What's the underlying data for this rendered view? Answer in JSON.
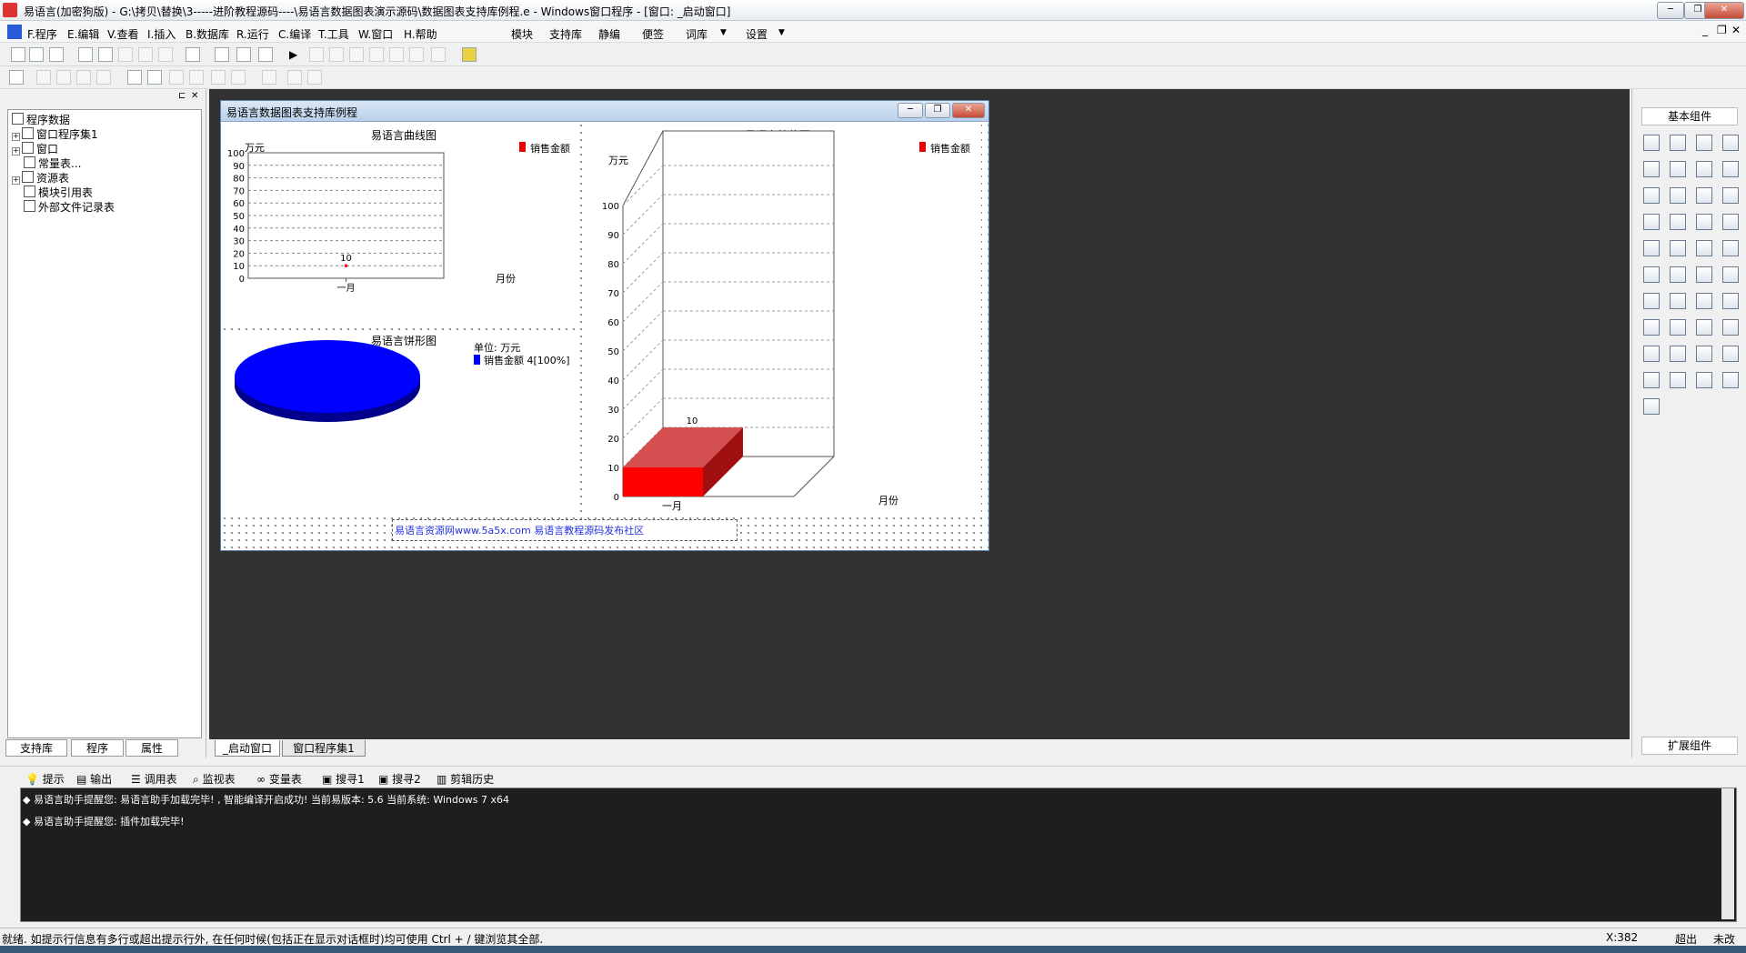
{
  "window": {
    "title": "易语言(加密狗版) - G:\\拷贝\\替换\\3-----进阶教程源码----\\易语言数据图表演示源码\\数据图表支持库例程.e - Windows窗口程序 - [窗口: _启动窗口]"
  },
  "menubar": {
    "items": [
      "F.程序",
      "E.编辑",
      "V.查看",
      "I.插入",
      "B.数据库",
      "R.运行",
      "C.编译",
      "T.工具",
      "W.窗口",
      "H.帮助"
    ],
    "right_items": [
      "模块",
      "支持库",
      "静编",
      "便签",
      "词库",
      "设置"
    ]
  },
  "leftpanel": {
    "tree": {
      "root": "程序数据",
      "children": [
        "窗口程序集1",
        "窗口",
        "常量表...",
        "资源表",
        "模块引用表",
        "外部文件记录表"
      ]
    },
    "tabs": [
      "支持库",
      "程序",
      "属性"
    ]
  },
  "editor_tabs": [
    "_启动窗口",
    "窗口程序集1"
  ],
  "form": {
    "title": "易语言数据图表支持库例程",
    "line_chart": {
      "title": "易语言曲线图",
      "legend": "销售金额",
      "ylabel": "万元",
      "xlabel": "月份"
    },
    "bar_chart": {
      "title": "易语言柱状图",
      "legend": "销售金额",
      "ylabel": "万元",
      "xlabel": "月份"
    },
    "pie_chart": {
      "title": "易语言饼形图",
      "unit": "单位: 万元",
      "legend": "销售金额 4[100%]"
    },
    "label_text": "易语言资源网www.5a5x.com 易语言教程源码发布社区"
  },
  "chart_data": [
    {
      "type": "line",
      "title": "易语言曲线图",
      "categories": [
        "一月"
      ],
      "series": [
        {
          "name": "销售金额",
          "values": [
            10
          ]
        }
      ],
      "ylabel": "万元",
      "xlabel": "月份",
      "ylim": [
        0,
        100
      ],
      "yticks": [
        0,
        10,
        20,
        30,
        40,
        50,
        60,
        70,
        80,
        90,
        100
      ],
      "color": "#ff0000"
    },
    {
      "type": "bar",
      "title": "易语言柱状图",
      "categories": [
        "一月"
      ],
      "series": [
        {
          "name": "销售金额",
          "values": [
            10
          ]
        }
      ],
      "ylabel": "万元",
      "xlabel": "月份",
      "ylim": [
        0,
        100
      ],
      "yticks": [
        0,
        10,
        20,
        30,
        40,
        50,
        60,
        70,
        80,
        90,
        100
      ],
      "color": "#ff0000"
    },
    {
      "type": "pie",
      "title": "易语言饼形图",
      "slices": [
        {
          "label": "销售金额",
          "value": 4,
          "percent": "100%"
        }
      ],
      "color": "#0000ff"
    }
  ],
  "toolbox": {
    "title": "基本组件",
    "footer": "扩展组件"
  },
  "output_tabs": [
    "提示",
    "输出",
    "调用表",
    "监视表",
    "变量表",
    "搜寻1",
    "搜寻2",
    "剪辑历史"
  ],
  "output_lines": [
    "◆ 易语言助手提醒您: 易语言助手加载完毕!  , 智能编译开启成功!  当前易版本: 5.6  当前系统: Windows 7 x64",
    "◆ 易语言助手提醒您: 插件加载完毕!"
  ],
  "statusbar": {
    "text": "就绪. 如提示行信息有多行或超出提示行外, 在任何时候(包括正在显示对话框时)均可使用 Ctrl + / 键浏览其全部.",
    "coord": "X:382",
    "mode1": "超出",
    "mode2": "未改"
  }
}
